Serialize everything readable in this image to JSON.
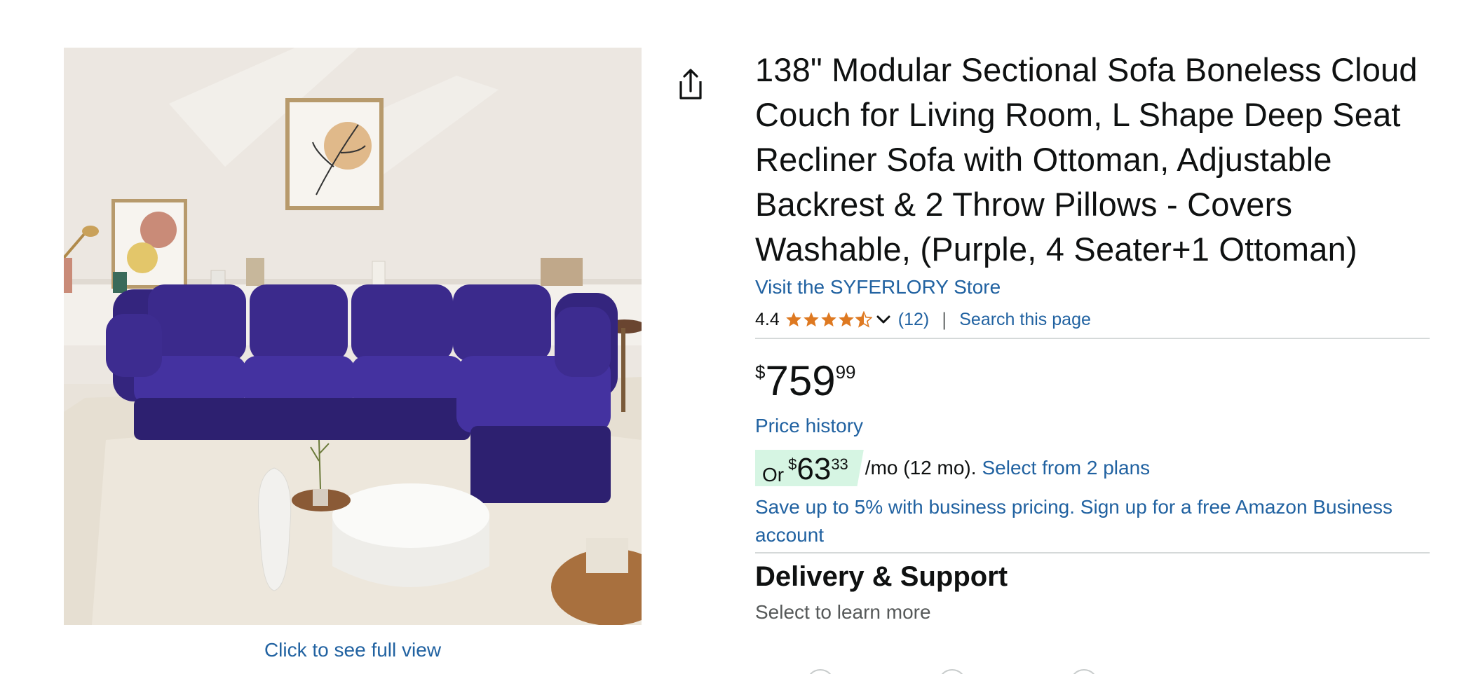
{
  "product": {
    "title": "138\" Modular Sectional Sofa Boneless Cloud Couch for Living Room, L Shape Deep Seat Recliner Sofa with Ottoman, Adjustable Backrest & 2 Throw Pillows - Covers Washable, (Purple, 4 Seater+1 Ottoman)",
    "store_link": "Visit the SYFERLORY Store",
    "image_caption": "Click to see full view",
    "colors": {
      "sofa": "#3b2a8c",
      "link": "#2162a1",
      "star": "#de7921",
      "badge": "#d6f5e3"
    }
  },
  "rating": {
    "value": "4.4",
    "stars": 4.4,
    "count": "(12)",
    "separator": "|",
    "search_link": "Search this page"
  },
  "price": {
    "symbol": "$",
    "whole": "759",
    "fraction": "99",
    "history_link": "Price history"
  },
  "monthly": {
    "prefix": "Or",
    "symbol": "$",
    "whole": "63",
    "fraction": "33",
    "suffix": "/mo (12 mo).",
    "plans_link": "Select from 2 plans"
  },
  "business": {
    "link": "Save up to 5% with business pricing. Sign up for a free Amazon Business account"
  },
  "delivery": {
    "heading": "Delivery & Support",
    "subtext": "Select to learn more"
  },
  "icons": {
    "share": "share-icon",
    "chevron": "chevron-down-icon",
    "star": "star-icon"
  }
}
